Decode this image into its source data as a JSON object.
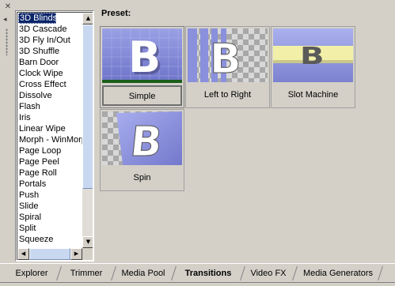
{
  "grip": {
    "close_glyph": "✕",
    "pin_glyph": "◂"
  },
  "list": {
    "items": [
      "3D Blinds",
      "3D Cascade",
      "3D Fly In/Out",
      "3D Shuffle",
      "Barn Door",
      "Clock Wipe",
      "Cross Effect",
      "Dissolve",
      "Flash",
      "Iris",
      "Linear Wipe",
      "Morph - WinMorph",
      "Page Loop",
      "Page Peel",
      "Page Roll",
      "Portals",
      "Push",
      "Slide",
      "Spiral",
      "Split",
      "Squeeze"
    ],
    "selected_index": 0,
    "scroll_up": "▲",
    "scroll_down": "▼",
    "scroll_left": "◀",
    "scroll_right": "▶"
  },
  "preset": {
    "label": "Preset:",
    "tiles": [
      {
        "label": "Simple",
        "selected": true
      },
      {
        "label": "Left to Right",
        "selected": false
      },
      {
        "label": "Slot Machine",
        "selected": false
      },
      {
        "label": "Spin",
        "selected": false
      }
    ]
  },
  "tabs": [
    {
      "label": "Explorer",
      "active": false
    },
    {
      "label": "Trimmer",
      "active": false
    },
    {
      "label": "Media Pool",
      "active": false
    },
    {
      "label": "Transitions",
      "active": true
    },
    {
      "label": "Video FX",
      "active": false
    },
    {
      "label": "Media Generators",
      "active": false
    }
  ],
  "colors": {
    "selection": "#0a246a",
    "face": "#d4d0c8",
    "thumb_blue": "#8a8fd8"
  }
}
